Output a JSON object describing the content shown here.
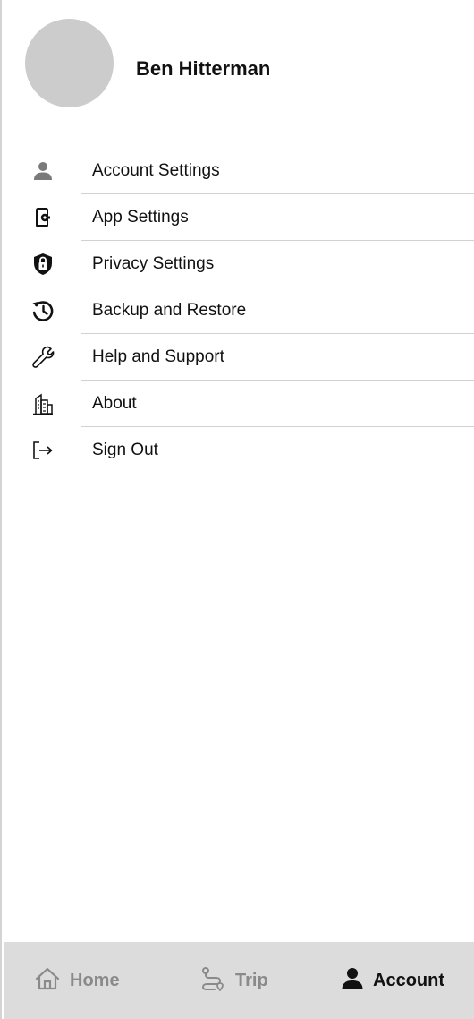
{
  "profile": {
    "name": "Ben Hitterman"
  },
  "menu": {
    "items": [
      {
        "label": "Account Settings",
        "icon": "person-icon"
      },
      {
        "label": "App Settings",
        "icon": "phone-gear-icon"
      },
      {
        "label": "Privacy Settings",
        "icon": "shield-lock-icon"
      },
      {
        "label": "Backup and Restore",
        "icon": "history-icon"
      },
      {
        "label": "Help and Support",
        "icon": "wrench-icon"
      },
      {
        "label": "About",
        "icon": "building-icon"
      },
      {
        "label": "Sign Out",
        "icon": "sign-out-icon"
      }
    ]
  },
  "tabbar": {
    "tabs": [
      {
        "label": "Home",
        "icon": "home-icon",
        "active": false
      },
      {
        "label": "Trip",
        "icon": "route-icon",
        "active": false
      },
      {
        "label": "Account",
        "icon": "person-icon",
        "active": true
      }
    ]
  },
  "colors": {
    "avatar": "#cccccc",
    "tabbar_background": "#dcdcdc",
    "inactive_tab": "#8a8a8a",
    "active_tab": "#111111",
    "divider": "#d2d2d2"
  }
}
